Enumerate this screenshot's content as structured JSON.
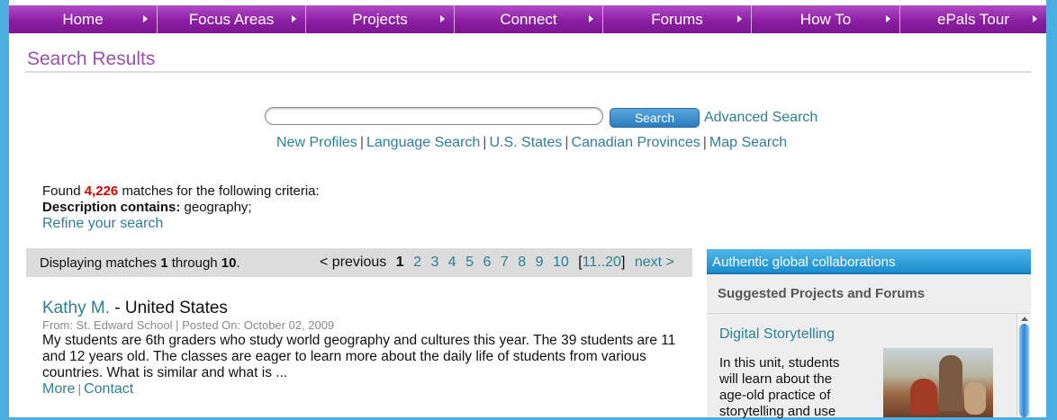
{
  "nav": {
    "items": [
      {
        "label": "Home"
      },
      {
        "label": "Focus Areas"
      },
      {
        "label": "Projects"
      },
      {
        "label": "Connect"
      },
      {
        "label": "Forums"
      },
      {
        "label": "How To"
      },
      {
        "label": "ePals Tour"
      }
    ]
  },
  "page": {
    "title": "Search Results"
  },
  "search": {
    "query": "",
    "button": "Search",
    "advanced": "Advanced Search",
    "links": [
      "New Profiles",
      "Language Search",
      "U.S. States",
      "Canadian Provinces",
      "Map Search"
    ],
    "separator": "|"
  },
  "summary": {
    "found_prefix": "Found",
    "count": "4,226",
    "found_suffix": "matches for the following criteria:",
    "criteria_label": "Description contains:",
    "criteria_value": "geography;",
    "refine": "Refine your search"
  },
  "pager": {
    "display_prefix": "Displaying matches",
    "from": "1",
    "through_word": "through",
    "to": "10",
    "period": ".",
    "previous": "< previous",
    "current": "1",
    "pages": [
      "2",
      "3",
      "4",
      "5",
      "6",
      "7",
      "8",
      "9",
      "10"
    ],
    "bracket_open": "[",
    "range": "11..20",
    "bracket_close": "]",
    "next": "next >"
  },
  "results": [
    {
      "name": "Kathy M.",
      "country": "- United States",
      "meta": "From: St. Edward School | Posted On: October 02, 2009",
      "description": "My students are 6th graders who study world geography and cultures this year. The 39 students are 11 and 12 years old. The classes are eager to learn more about the daily life of students from various countries. What is similar and what is ...",
      "more": "More",
      "contact": "Contact",
      "separator": "|"
    }
  ],
  "sidebar": {
    "header": "Authentic global collaborations",
    "subheader": "Suggested Projects and Forums",
    "project_title": "Digital Storytelling",
    "project_text": "In this unit, students will learn about the age-old practice of storytelling and use"
  },
  "colors": {
    "nav_purple": "#8c1fa3",
    "title_purple": "#9a4fb4",
    "link_teal": "#2d7f93",
    "count_red": "#e00000",
    "sidebar_blue": "#1c8ccd"
  }
}
